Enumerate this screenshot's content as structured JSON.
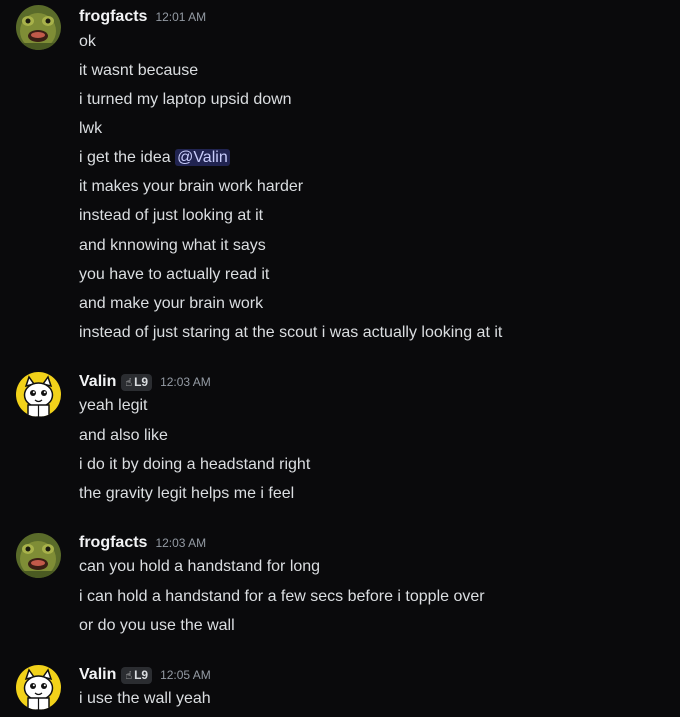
{
  "groups": [
    {
      "username": "frogfacts",
      "timestamp": "12:01 AM",
      "messages": [
        "ok",
        "it wasnt because",
        "i turned my laptop upsid down",
        "lwk",
        "i get the idea",
        "it makes your brain work harder",
        "instead of just looking at it",
        "and knnowing what it says",
        "you have to actually read it",
        "and make your brain work",
        "instead of just staring at the scout i was actually looking at it"
      ],
      "mention": "@Valin"
    },
    {
      "username": "Valin",
      "tag": "L9",
      "timestamp": "12:03 AM",
      "messages": [
        "yeah legit",
        "and also like",
        "i do it by doing a headstand right",
        "the gravity legit helps me i feel"
      ]
    },
    {
      "username": "frogfacts",
      "timestamp": "12:03 AM",
      "messages": [
        "can you hold a handstand for long",
        "i can hold a handstand for a few secs before i topple over",
        "or do you use the wall"
      ]
    },
    {
      "username": "Valin",
      "tag": "L9",
      "timestamp": "12:05 AM",
      "messages": [
        "i use the wall yeah"
      ]
    }
  ],
  "colors": {
    "background": "#0a0a0c",
    "mention_bg": "#2b2f5e",
    "mention_text": "#c9cdfb"
  },
  "icons": {
    "frogfacts_avatar": "frog-avatar",
    "valin_avatar": "cartoon-cat-avatar",
    "tag_icon": "hand-icon"
  }
}
